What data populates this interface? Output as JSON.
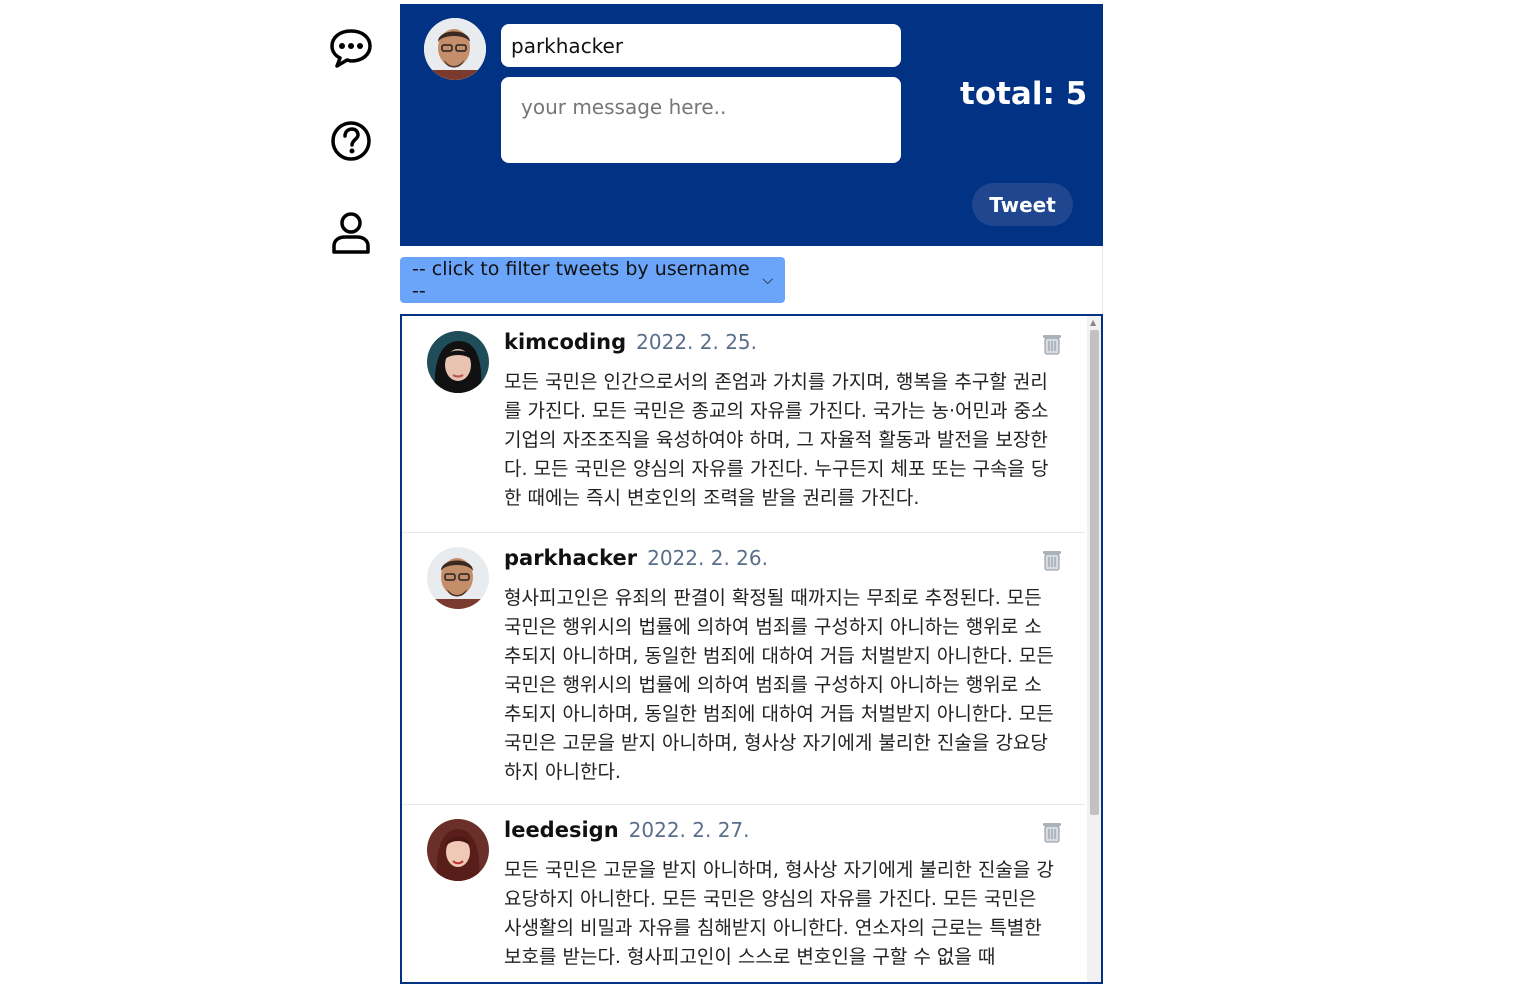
{
  "sidebar": {
    "items": [
      {
        "icon": "chat-icon"
      },
      {
        "icon": "help-icon"
      },
      {
        "icon": "user-icon"
      }
    ]
  },
  "header": {
    "username": "parkhacker",
    "message_placeholder": "your message here..",
    "total_text": "total: 5",
    "tweet_button": "Tweet"
  },
  "filter": {
    "label": "-- click to filter tweets by username --"
  },
  "tweets": [
    {
      "username": "kimcoding",
      "date": "2022. 2. 25.",
      "content": "모든 국민은 인간으로서의 존엄과 가치를 가지며, 행복을 추구할 권리를 가진다. 모든 국민은 종교의 자유를 가진다. 국가는 농·어민과 중소기업의 자조조직을 육성하여야 하며, 그 자율적 활동과 발전을 보장한다. 모든 국민은 양심의 자유를 가진다. 누구든지 체포 또는 구속을 당한 때에는 즉시 변호인의 조력을 받을 권리를 가진다."
    },
    {
      "username": "parkhacker",
      "date": "2022. 2. 26.",
      "content": "형사피고인은 유죄의 판결이 확정될 때까지는 무죄로 추정된다. 모든 국민은 행위시의 법률에 의하여 범죄를 구성하지 아니하는 행위로 소추되지 아니하며, 동일한 범죄에 대하여 거듭 처벌받지 아니한다. 모든 국민은 행위시의 법률에 의하여 범죄를 구성하지 아니하는 행위로 소추되지 아니하며, 동일한 범죄에 대하여 거듭 처벌받지 아니한다. 모든 국민은 고문을 받지 아니하며, 형사상 자기에게 불리한 진술을 강요당하지 아니한다."
    },
    {
      "username": "leedesign",
      "date": "2022. 2. 27.",
      "content": "모든 국민은 고문을 받지 아니하며, 형사상 자기에게 불리한 진술을 강요당하지 아니한다. 모든 국민은 양심의 자유를 가진다. 모든 국민은 사생활의 비밀과 자유를 침해받지 아니한다. 연소자의 근로는 특별한 보호를 받는다. 형사피고인이 스스로 변호인을 구할 수 없을 때"
    }
  ],
  "colors": {
    "header_bg": "#013283",
    "filter_bg": "#6aa5fa",
    "tweet_button_bg": "#1f468e"
  }
}
